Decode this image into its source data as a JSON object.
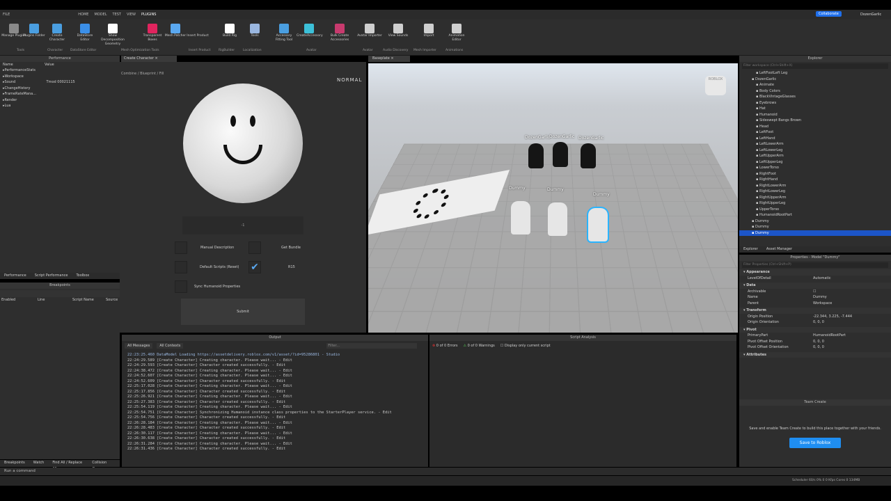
{
  "menu": [
    "FILE",
    "HOME",
    "MODEL",
    "TEST",
    "VIEW",
    "PLUGINS"
  ],
  "top_right": {
    "collaborate": "Collaborate",
    "user": "DozenGarlic"
  },
  "ribbon": [
    {
      "label": "Manage Plugins",
      "icon": "gear-icon",
      "color": "#8a8a8a"
    },
    {
      "label": "Plugins Folder",
      "icon": "folder-icon",
      "color": "#4a9ee0"
    },
    {
      "label": "Create Character",
      "icon": "character-icon",
      "color": "#4a9ee0"
    },
    {
      "label": "DataStore Editor",
      "icon": "database-icon",
      "color": "#3b8fe8"
    },
    {
      "label": "Show Decomposition Geometry",
      "icon": "geometry-icon",
      "color": "#ffffff"
    },
    {
      "label": "Transparent Boxes",
      "icon": "box-icon",
      "color": "#e0245e"
    },
    {
      "label": "Mesh Patcher",
      "icon": "mesh-icon",
      "color": "#5aa8f0"
    },
    {
      "label": "Insert Product",
      "icon": "product-icon",
      "color": "#2e2e2e"
    },
    {
      "label": "Build Rig",
      "icon": "rig-icon",
      "color": "#ffffff"
    },
    {
      "label": "Tools",
      "icon": "globe-icon",
      "color": "#9ab7e0"
    },
    {
      "label": "Accessory Fitting Tool",
      "icon": "accessory-icon",
      "color": "#4a9ee0"
    },
    {
      "label": "CreateAccessory",
      "icon": "hat-icon",
      "color": "#3cc0d8"
    },
    {
      "label": "Bulk Create Accessories",
      "icon": "bulk-icon",
      "color": "#c83a6e"
    },
    {
      "label": "Avatar Importer",
      "icon": "import-icon",
      "color": "#cfcfcf"
    },
    {
      "label": "View Sounds",
      "icon": "sound-icon",
      "color": "#cfcfcf"
    },
    {
      "label": "Import",
      "icon": "upload-icon",
      "color": "#cfcfcf"
    },
    {
      "label": "Animation Editor",
      "icon": "animation-icon",
      "color": "#cfcfcf"
    }
  ],
  "ribbon_groups": [
    "Tools",
    "Character",
    "DataStore Editor",
    "Mesh Optimization Tools",
    "Insert Product",
    "RigBuilder",
    "Localization",
    "Avatar",
    "Avatar",
    "Audio Discovery",
    "Mesh Importer",
    "Animations"
  ],
  "performance": {
    "title": "Performance",
    "col_name": "Name",
    "col_value": "Value",
    "rows": [
      [
        "PerformanceStats",
        ""
      ],
      [
        "Workspace",
        ""
      ],
      [
        "Sound",
        "Tmod 00021115"
      ],
      [
        "ChangeHistory",
        ""
      ],
      [
        "FrameRateMana...",
        ""
      ],
      [
        "Render",
        ""
      ],
      [
        "Lua",
        ""
      ]
    ],
    "tabs": [
      "Performance",
      "Script Performance",
      "Toolbox"
    ]
  },
  "breakpoints": {
    "title": "Breakpoints",
    "cols": [
      "Enabled",
      "Line",
      "Script Name",
      "Source"
    ],
    "tabs": [
      "Breakpoints",
      "Watch",
      "Find All / Replace All",
      "Collision Group"
    ]
  },
  "create_character": {
    "tab": "Create Character",
    "subtitle": "Combine / Blueprint / Fill",
    "mode": "NORMAL",
    "input_value": "-1",
    "options": [
      "Manual Description",
      "Get Bundle",
      "Default Scripts (Reset)",
      "R15",
      "Sync Humanoid Properties"
    ],
    "submit": "Submit"
  },
  "viewport": {
    "tab": "Baseplate",
    "labels": [
      "DozenGarlic",
      "DozenGarlic",
      "DozenGarlic",
      "Dummy",
      "Dummy",
      "Dummy"
    ],
    "top_badge": "ROBLOX"
  },
  "output": {
    "title": "Output",
    "filter1": "All Messages",
    "filter2": "All Contexts",
    "filter_placeholder": "Filter...",
    "lines": [
      "22:23:25.460  DataModel Loading https://assetdelivery.roblox.com/v1/asset/?id=95286801  -  Studio",
      "22:24:29.589  [Create Character] Creating character. Please wait...  -  Edit",
      "22:24:29.593  [Create Character] Character created successfully.  -  Edit",
      "22:24:38.472  [Create Character] Creating character. Please wait...  -  Edit",
      "22:24:52.607  [Create Character] Creating character. Please wait...  -  Edit",
      "22:24:52.609  [Create Character] Character created successfully.  -  Edit",
      "22:25:17.028  [Create Character] Creating character. Please wait...  -  Edit",
      "22:25:17.856  [Create Character] Character created successfully.  -  Edit",
      "22:25:26.921  [Create Character] Creating character. Please wait...  -  Edit",
      "22:25:27.383  [Create Character] Character created successfully.  -  Edit",
      "22:25:54.119  [Create Character] Creating character. Please wait...  -  Edit",
      "22:25:54.751  [Create Character] Synchronizing Humanoid instance class properties to the StarterPlayer service.  -  Edit",
      "22:25:54.756  [Create Character] Character created successfully.  -  Edit",
      "22:26:28.184  [Create Character] Creating character. Please wait...  -  Edit",
      "22:26:28.483  [Create Character] Character created successfully.  -  Edit",
      "22:26:30.117  [Create Character] Creating character. Please wait...  -  Edit",
      "22:26:30.638  [Create Character] Character created successfully.  -  Edit",
      "22:26:31.284  [Create Character] Creating character. Please wait...  -  Edit",
      "22:26:31.436  [Create Character] Character created successfully.  -  Edit"
    ]
  },
  "script_analysis": {
    "title": "Script Analysis",
    "errors": "0 of 0 Errors",
    "warnings": "0 of 0 Warnings",
    "current": "Display only current script"
  },
  "explorer": {
    "title": "Explorer",
    "filter": "Filter workspace (Ctrl+Shift+X)",
    "items": [
      "LeftFootLeft Leg",
      "DozenGarlic",
      "Animate",
      "Body Colors",
      "BlackVintageGlasses",
      "Eyebrows",
      "Hat",
      "Humanoid",
      "Sideswept Bangs Brown",
      "Head",
      "LeftFoot",
      "LeftHand",
      "LeftLowerArm",
      "LeftLowerLeg",
      "LeftUpperArm",
      "LeftUpperLeg",
      "LowerTorso",
      "RightFoot",
      "RightHand",
      "RightLowerArm",
      "RightLowerLeg",
      "RightUpperArm",
      "RightUpperLeg",
      "UpperTorso",
      "HumanoidRootPart",
      "Dummy",
      "Dummy",
      "Dummy"
    ],
    "tabs": [
      "Explorer",
      "Asset Manager"
    ]
  },
  "properties": {
    "title": "Properties - Model \"Dummy\"",
    "filter": "Filter Properties (Ctrl+Shift+P)",
    "sections": [
      {
        "name": "Appearance",
        "rows": [
          [
            "LevelOfDetail",
            "Automatic"
          ]
        ]
      },
      {
        "name": "Data",
        "rows": [
          [
            "Archivable",
            "☐"
          ],
          [
            "Name",
            "Dummy"
          ],
          [
            "Parent",
            "Workspace"
          ]
        ]
      },
      {
        "name": "Transform",
        "rows": [
          [
            "Origin Position",
            "-22.344, 3.225, -7.444"
          ],
          [
            "Origin Orientation",
            "0, 0, 0"
          ]
        ]
      },
      {
        "name": "Pivot",
        "rows": [
          [
            "PrimaryPart",
            "HumanoidRootPart"
          ],
          [
            "Pivot Offset Position",
            "0, 0, 0"
          ],
          [
            "Pivot Offset Orientation",
            "0, 0, 0"
          ]
        ]
      },
      {
        "name": "Attributes",
        "rows": []
      }
    ]
  },
  "team_create": {
    "title": "Team Create",
    "text": "Save and enable Team Create to build this place together with your friends.",
    "button": "Save to Roblox"
  },
  "command": {
    "placeholder": "Run a command"
  },
  "status": {
    "text": "Scheduler 60/s 0%   0   0 Kfps   Cores 0   134MB"
  },
  "colors": {
    "accent": "#1f6feb",
    "selection": "#1c55c8"
  }
}
